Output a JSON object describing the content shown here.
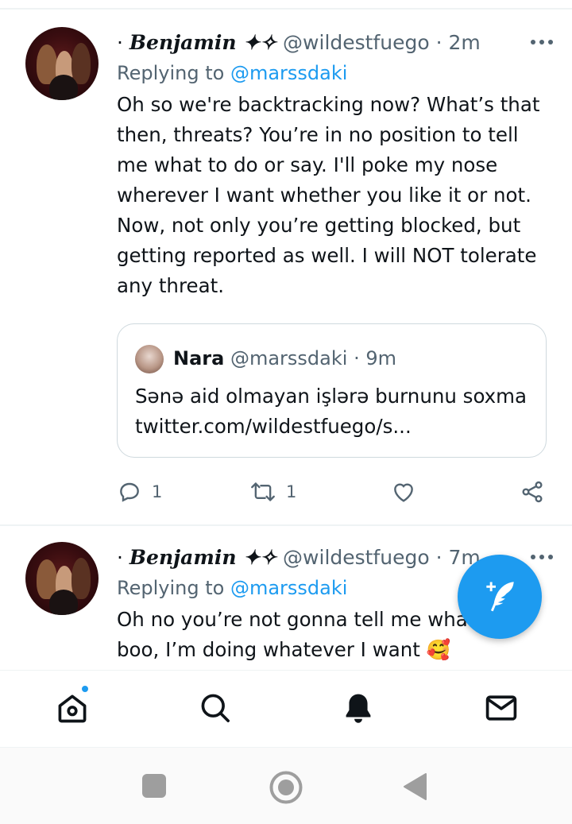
{
  "tweets": [
    {
      "bullet": "·",
      "display_name": "Benjamin ✦✧",
      "handle": "@wildestfuego",
      "separator": "·",
      "time": "2m",
      "replying_prefix": "Replying to",
      "replying_to": "@marssdaki",
      "text": "Oh so we're backtracking now? What’s that then, threats? You’re in no position to tell me what to do or say. I'll poke my nose wherever I want whether you like it or not. Now, not only you’re getting blocked, but getting reported as well. I will NOT tolerate any threat.",
      "quote": {
        "name": "Nara",
        "handle": "@marssdaki",
        "separator": "·",
        "time": "9m",
        "text": "Sənə aid olmayan işlərə burnunu soxma twitter.com/wildestfuego/s..."
      },
      "actions": {
        "reply_count": "1",
        "retweet_count": "1"
      }
    },
    {
      "bullet": "·",
      "display_name": "Benjamin ✦✧",
      "handle": "@wildestfuego",
      "separator": "·",
      "time": "7m",
      "replying_prefix": "Replying to",
      "replying_to": "@marssdaki",
      "text": "Oh no you’re not gonna tell me what to do boo, I’m doing whatever I want 🥰"
    }
  ],
  "colors": {
    "accent": "#1d9bf0",
    "muted": "#536471",
    "text": "#0f1419",
    "border": "#cfd9de"
  },
  "bottom_nav": [
    "home-icon",
    "search-icon",
    "notifications-bell-icon",
    "messages-envelope-icon"
  ],
  "system_nav": [
    "recents-square-icon",
    "home-circle-icon",
    "back-triangle-icon"
  ]
}
